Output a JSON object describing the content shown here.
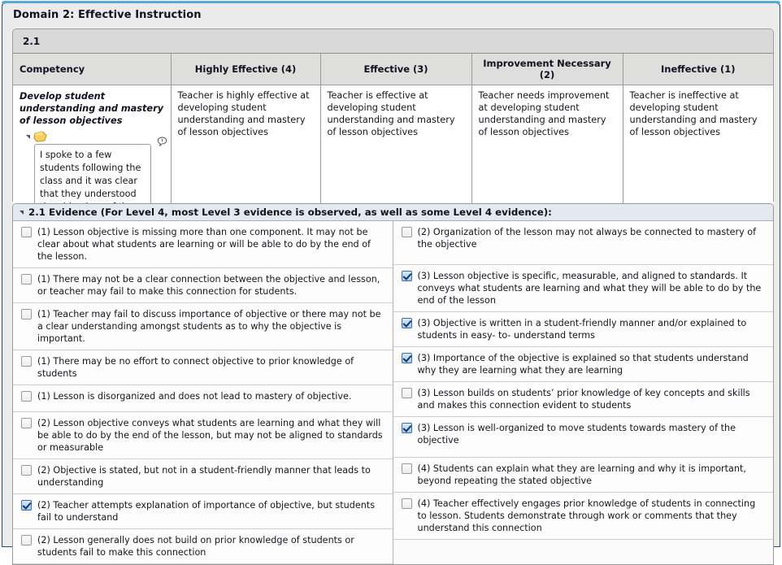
{
  "domain": {
    "title": "Domain 2: Effective Instruction"
  },
  "rubric": {
    "section_label": "2.1",
    "columns": [
      "Competency",
      "Highly Effective (4)",
      "Effective (3)",
      "Improvement Necessary (2)",
      "Ineffective (1)"
    ],
    "competency": "Develop student understanding and mastery of lesson objectives",
    "levels": [
      {
        "key": "highly_effective",
        "text": "Teacher is highly effective at developing student understanding and mastery of lesson objectives",
        "selected": false
      },
      {
        "key": "effective",
        "text": "Teacher is effective at developing student understanding and mastery of lesson objectives",
        "selected": true
      },
      {
        "key": "improvement_necessary",
        "text": "Teacher needs improvement at developing student understanding and mastery of lesson objectives",
        "selected": false
      },
      {
        "key": "ineffective",
        "text": "Teacher is ineffective at developing student understanding and mastery of lesson objectives",
        "selected": false
      }
    ],
    "selected_level_color": "#f6b70b",
    "note": {
      "value": "I spoke to a few students following the class and it was clear that they understood the objectives of the lesson.",
      "placeholder": ""
    }
  },
  "evidence": {
    "header": "2.1 Evidence (For Level 4, most Level 3 evidence is observed, as well as some Level 4 evidence):",
    "left_items": [
      {
        "label": "(1) Lesson objective is missing more than one component. It may not be clear about what students are learning or will be able to do by the end of the lesson.",
        "checked": false
      },
      {
        "label": "(1) There may not be a clear connection between the objective and lesson, or teacher may fail to make this connection for students.",
        "checked": false
      },
      {
        "label": "(1) Teacher may fail to discuss importance of objective or there may not be a clear understanding amongst students as to why the objective is important.",
        "checked": false
      },
      {
        "label": "(1) There may be no effort to connect objective to prior knowledge of students",
        "checked": false
      },
      {
        "label": "(1) Lesson is disorganized and does not lead to mastery of objective.",
        "checked": false
      },
      {
        "label": "(2) Lesson objective conveys what students are learning and what they will be able to do by the end of the lesson, but may not be aligned to standards or measurable",
        "checked": false
      },
      {
        "label": "(2) Objective is stated, but not in a student-friendly manner that leads to understanding",
        "checked": false
      },
      {
        "label": "(2) Teacher attempts explanation of importance of objective, but students fail to understand",
        "checked": true
      },
      {
        "label": "(2) Lesson generally does not build on prior knowledge of students or students fail to make this connection",
        "checked": false
      }
    ],
    "right_items": [
      {
        "label": "(2) Organization of the lesson may not always be connected to mastery of the objective",
        "checked": false
      },
      {
        "label": "(3) Lesson objective is specific, measurable, and aligned to standards. It conveys what students are learning and what they will be able to do by the end of the lesson",
        "checked": true
      },
      {
        "label": "(3) Objective is written in a student-friendly manner and/or explained to students in easy- to- understand terms",
        "checked": true
      },
      {
        "label": "(3) Importance of the objective is explained so that students understand why they are learning what they are learning",
        "checked": true
      },
      {
        "label": "(3) Lesson builds on students’ prior knowledge of key concepts and skills and makes this connection evident to students",
        "checked": false
      },
      {
        "label": "(3) Lesson is well-organized to move students towards mastery of the objective",
        "checked": true
      },
      {
        "label": "(4) Students can explain what they are learning and why it is important, beyond repeating the stated objective",
        "checked": false
      },
      {
        "label": "(4) Teacher effectively engages prior knowledge of students in connecting to lesson. Students demonstrate through work or comments that they understand this connection",
        "checked": false
      }
    ]
  },
  "icons": {
    "note": "sticky-note-icon",
    "comment_badge": "comment-bubble-icon",
    "collapse": "collapse-triangle-icon",
    "resize": "resize-grip-icon"
  }
}
